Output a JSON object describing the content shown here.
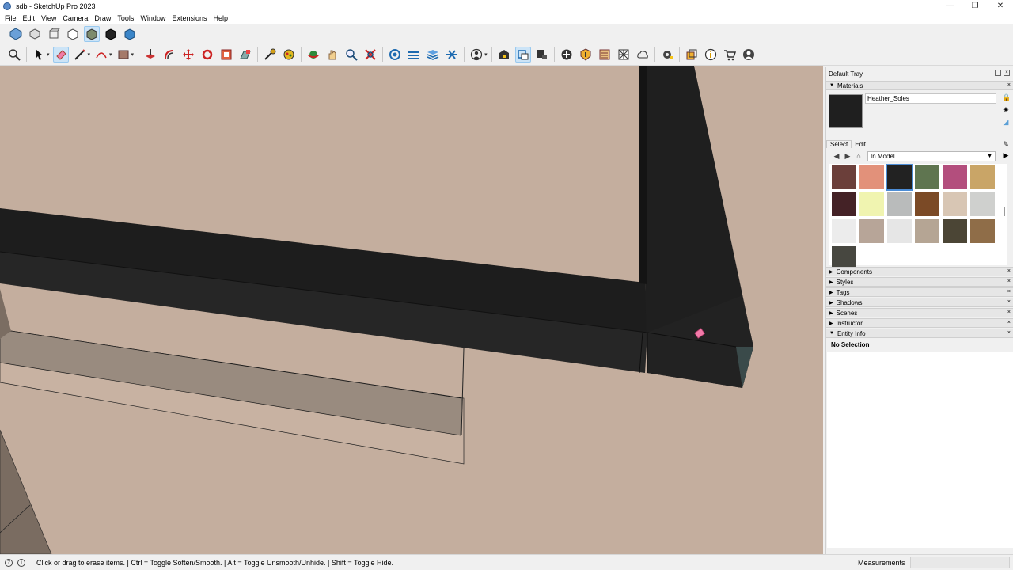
{
  "window": {
    "title": "sdb - SketchUp Pro 2023",
    "controls": [
      "—",
      "❐",
      "✕"
    ]
  },
  "menu": [
    "File",
    "Edit",
    "View",
    "Camera",
    "Draw",
    "Tools",
    "Window",
    "Extensions",
    "Help"
  ],
  "toolbar_views": [
    "iso-view-icon",
    "top-view-icon",
    "front-view-icon",
    "right-view-icon",
    "back-view-icon",
    "left-view-icon",
    "bottom-view-icon"
  ],
  "toolbar_main": [
    "zoom-icon",
    "select-icon",
    "eraser-icon",
    "line-icon",
    "arc-icon",
    "rectangle-icon",
    "push-pull-icon",
    "offset-icon",
    "move-icon",
    "rotate-icon",
    "scale-icon",
    "follow-me-icon",
    "tape-measure-icon",
    "paint-bucket-icon",
    "orbit-icon",
    "pan-icon",
    "zoom-window-icon",
    "zoom-extents-icon",
    "section-plane-icon",
    "sandbox-icon",
    "layers-icon",
    "terrain-icon",
    "profile-icon",
    "warehouse-icon",
    "extension-icon",
    "component-icon",
    "display-section-icon",
    "add-location-icon",
    "styles-icon",
    "classifier-icon",
    "solid-tools-icon",
    "cloud-icon",
    "settings-icon",
    "outliner-icon",
    "info-icon",
    "cart-icon",
    "account-icon"
  ],
  "tray": {
    "title": "Default Tray",
    "materials": {
      "title": "Materials",
      "current_name": "Heather_Soles",
      "tabs": [
        "Select",
        "Edit"
      ],
      "library": "In Model",
      "swatch_colors": [
        "#6b3f3a",
        "#e2917a",
        "#222222",
        "#5f7550",
        "#b34e7d",
        "#c9a567",
        "#442226",
        "#f0f4b0",
        "#b9bbbb",
        "#7b4a26",
        "#d8c6b4",
        "#cfd0ce",
        "#ececec",
        "#b7a598",
        "#e6e6e6",
        "#b5a594",
        "#4b4535",
        "#8f6d48",
        "#474740"
      ]
    },
    "panels": [
      "Components",
      "Styles",
      "Tags",
      "Shadows",
      "Scenes",
      "Instructor",
      "Entity Info"
    ],
    "entity_info": "No Selection"
  },
  "status": {
    "text": "Click or drag to erase items. | Ctrl = Toggle Soften/Smooth. | Alt = Toggle Unsmooth/Unhide. | Shift = Toggle Hide.",
    "measurements_label": "Measurements"
  },
  "colors": {
    "background": "#c4ae9e",
    "beam_dark": "#1d1d1d",
    "beam_top": "#141414",
    "board_light": "#998b7f"
  }
}
